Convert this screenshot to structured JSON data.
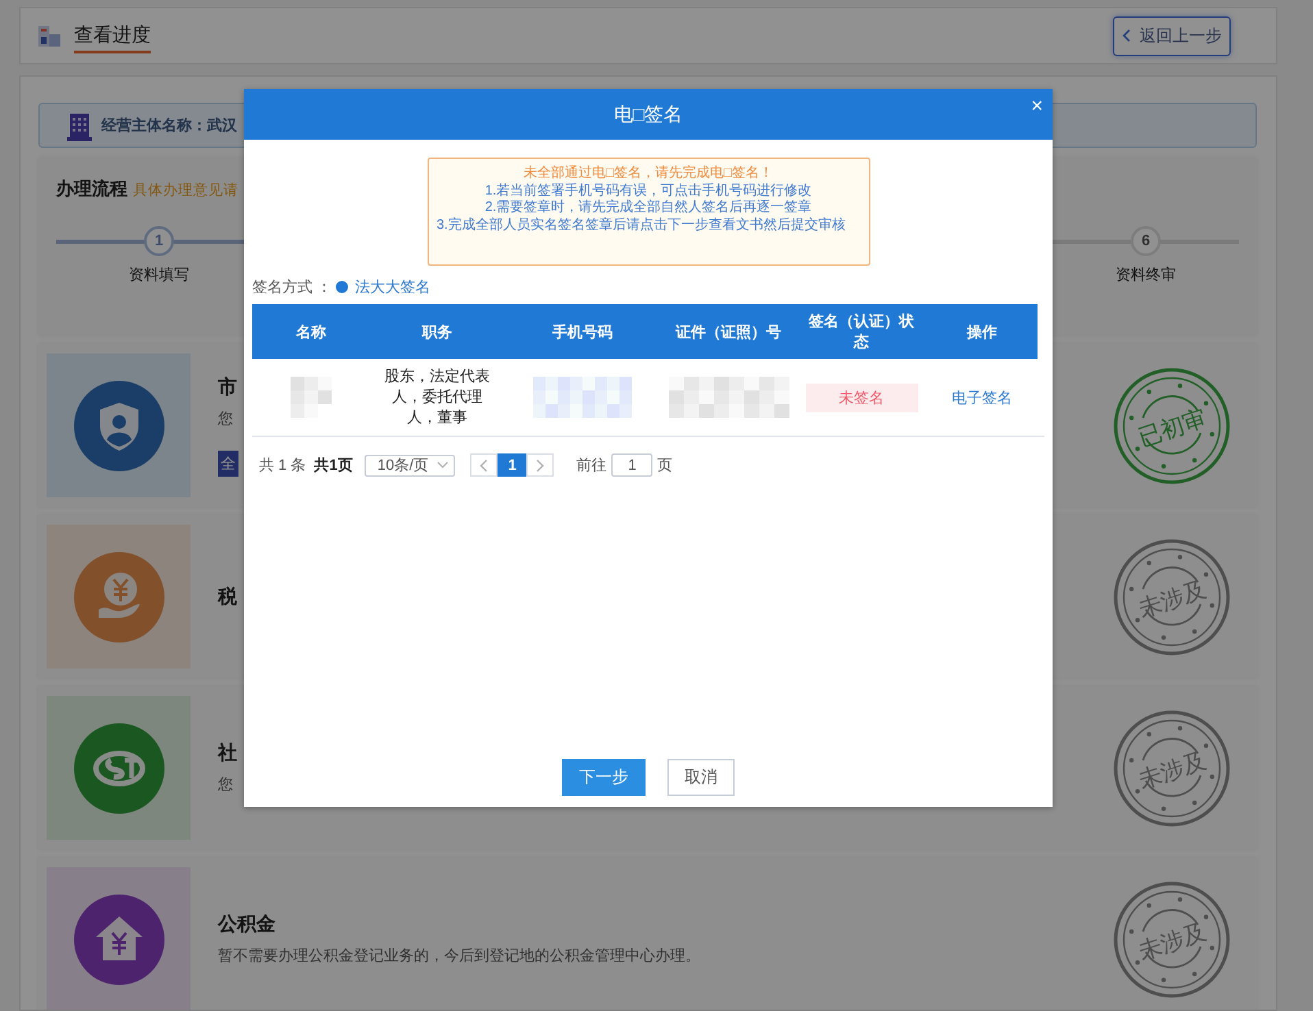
{
  "header": {
    "title": "查看进度",
    "back_button": "返回上一步"
  },
  "entity": {
    "label": "经营主体名称：武汉"
  },
  "process": {
    "title": "办理流程",
    "hint": "具体办理意见请",
    "steps": [
      {
        "number": "1",
        "label": "资料填写",
        "done": true
      },
      {
        "number": "6",
        "label": "资料终审",
        "done": false
      }
    ]
  },
  "services": [
    {
      "kind": "market",
      "title": "市",
      "description": "您",
      "badge": "全",
      "stamp": {
        "kind": "approved",
        "text": "已初审"
      }
    },
    {
      "kind": "tax",
      "title": "税",
      "stamp": {
        "kind": "none",
        "text": "未涉及"
      }
    },
    {
      "kind": "social",
      "title": "社",
      "description": "您",
      "stamp": {
        "kind": "none",
        "text": "未涉及"
      }
    },
    {
      "kind": "fund",
      "title": "公积金",
      "description": "暂不需要办理公积金登记业务的，今后到登记地的公积金管理中心办理。",
      "stamp": {
        "kind": "none",
        "text": "未涉及"
      }
    }
  ],
  "modal": {
    "title": "电□签名",
    "close": "×",
    "notice": {
      "warning": "未全部通过电□签名，请先完成电□签名！",
      "lines": [
        "1.若当前签署手机号码有误，可点击手机号码进行修改",
        "2.需要签章时，请先完成全部自然人签名后再逐一签章",
        "3.完成全部人员实名签名签章后请点击下一步查看文书然后提交审核"
      ]
    },
    "sign_method": {
      "label": "签名方式 ：",
      "options": [
        {
          "label": "法大大签名",
          "selected": true
        }
      ]
    },
    "table": {
      "columns": [
        "名称",
        "职务",
        "手机号码",
        "证件（证照）号",
        "签名（认证）状态",
        "操作"
      ],
      "rows": [
        {
          "cells": [
            {
              "kind": "redacted"
            },
            {
              "kind": "text",
              "text": "股东，法定代表人，委托代理人，董事"
            },
            {
              "kind": "redacted"
            },
            {
              "kind": "redacted"
            },
            {
              "kind": "status",
              "text": "未签名"
            },
            {
              "kind": "link",
              "text": "电子签名"
            }
          ]
        }
      ]
    },
    "pagination": {
      "total": "共 1 条",
      "pages": "共1页",
      "page_size": "10条/页",
      "pages_list": [
        {
          "label": "1",
          "selected": true
        }
      ],
      "goto_label": "前往",
      "goto_value": "1",
      "goto_suffix": "页"
    },
    "buttons": [
      {
        "label": "下一步",
        "primary": true
      },
      {
        "label": "取消",
        "primary": false
      }
    ]
  }
}
